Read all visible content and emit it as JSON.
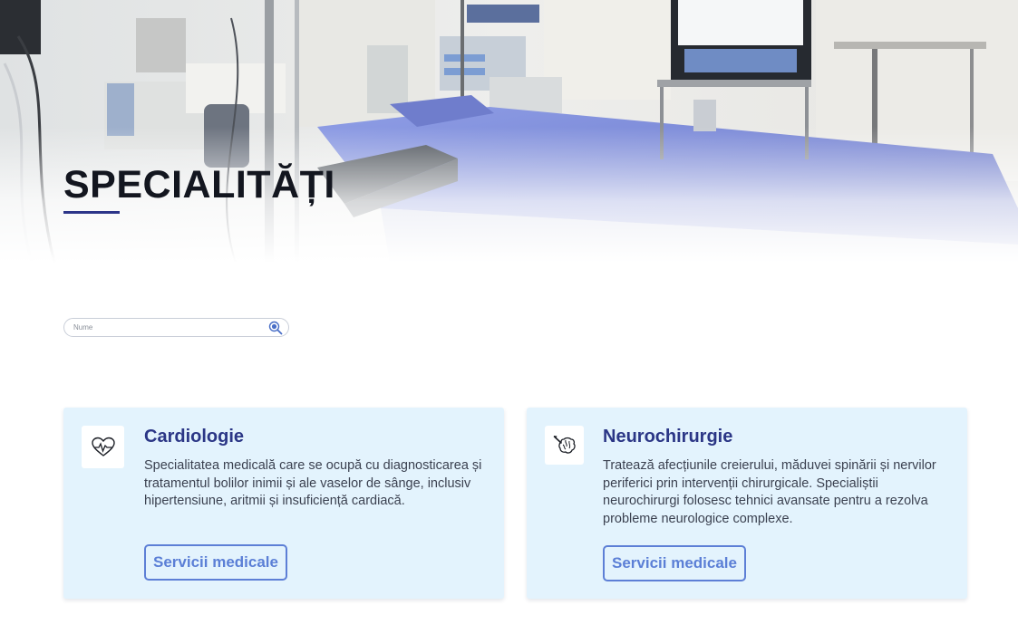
{
  "hero": {
    "title": "SPECIALITĂȚI",
    "image": "operating-room-photo"
  },
  "search": {
    "placeholder": "Nume",
    "icon": "search-icon"
  },
  "cards": [
    {
      "icon": "heartbeat-icon",
      "title": "Cardiologie",
      "description": "Specialitatea medicală care se ocupă cu diagnosticarea și tratamentul bolilor inimii și ale vaselor de sânge, inclusiv hipertensiune, aritmii și insuficiență cardiacă.",
      "button_label": "Servicii medicale"
    },
    {
      "icon": "brain-scalpel-icon",
      "title": "Neurochirurgie",
      "description": "Tratează afecțiunile creierului, măduvei spinării și nervilor periferici prin intervenții chirurgicale. Specialiștii neurochirurgi folosesc tehnici avansate pentru a rezolva probleme neurologice complexe.",
      "button_label": "Servicii medicale"
    }
  ],
  "colors": {
    "accent": "#2b3686",
    "button": "#5b7fd6",
    "card_background": "#e3f3fd"
  }
}
